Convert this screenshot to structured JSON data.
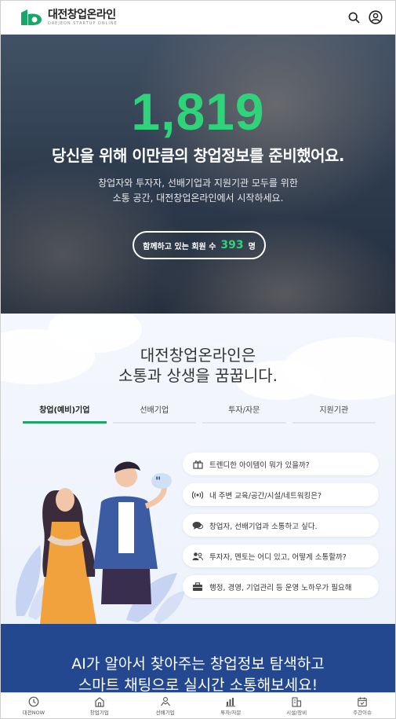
{
  "header": {
    "logo_title": "대전창업온라인",
    "logo_sub": "DAEJEON STARTUP ONLINE",
    "icons": [
      "search-icon",
      "user-icon"
    ],
    "brand_color": "#1aa56a"
  },
  "hero": {
    "count": "1,819",
    "title": "당신을 위해 이만큼의 창업정보를 준비했어요.",
    "desc_line1": "창업자와 투자자, 선배기업과 지원기관 모두를 위한",
    "desc_line2": "소통 공간, 대전창업온라인에서 시작하세요.",
    "member_label": "함께하고 있는 회원 수",
    "member_count": "393",
    "member_unit": "명",
    "accent_color": "#2fd37a"
  },
  "community": {
    "title_line1": "대전창업온라인은",
    "title_line2": "소통과 상생을 꿈꿉니다.",
    "tabs": [
      {
        "label": "창업(예비)기업",
        "active": true
      },
      {
        "label": "선배기업",
        "active": false
      },
      {
        "label": "투자/자문",
        "active": false
      },
      {
        "label": "지원기관",
        "active": false
      }
    ],
    "bubbles": [
      {
        "icon": "gift-icon",
        "text": "트렌디한 아이템이 뭐가 있을까?"
      },
      {
        "icon": "signal-icon",
        "text": "내 주변 교육/공간/시설/네트워킹은?"
      },
      {
        "icon": "chat-icon",
        "text": "창업자, 선배기업과 소통하고 싶다."
      },
      {
        "icon": "people-icon",
        "text": "투자자, 멘토는 어디 있고, 어떻게 소통할까?"
      },
      {
        "icon": "briefcase-icon",
        "text": "행정, 경영, 기업관리 등 운영 노하우가 필요해"
      }
    ]
  },
  "ai_band": {
    "line1": "AI가 알아서 찾아주는 창업정보 탐색하고",
    "line2": "스마트 채팅으로 실시간 소통해보세요!",
    "color": "#24488f"
  },
  "bottom_nav": [
    {
      "icon": "clock-icon",
      "label": "대전NOW"
    },
    {
      "icon": "building-icon",
      "label": "창업기업"
    },
    {
      "icon": "handshake-icon",
      "label": "선배기업"
    },
    {
      "icon": "chart-icon",
      "label": "투자/자문"
    },
    {
      "icon": "facility-icon",
      "label": "시설/장비"
    },
    {
      "icon": "calendar-icon",
      "label": "주간이슈"
    }
  ]
}
